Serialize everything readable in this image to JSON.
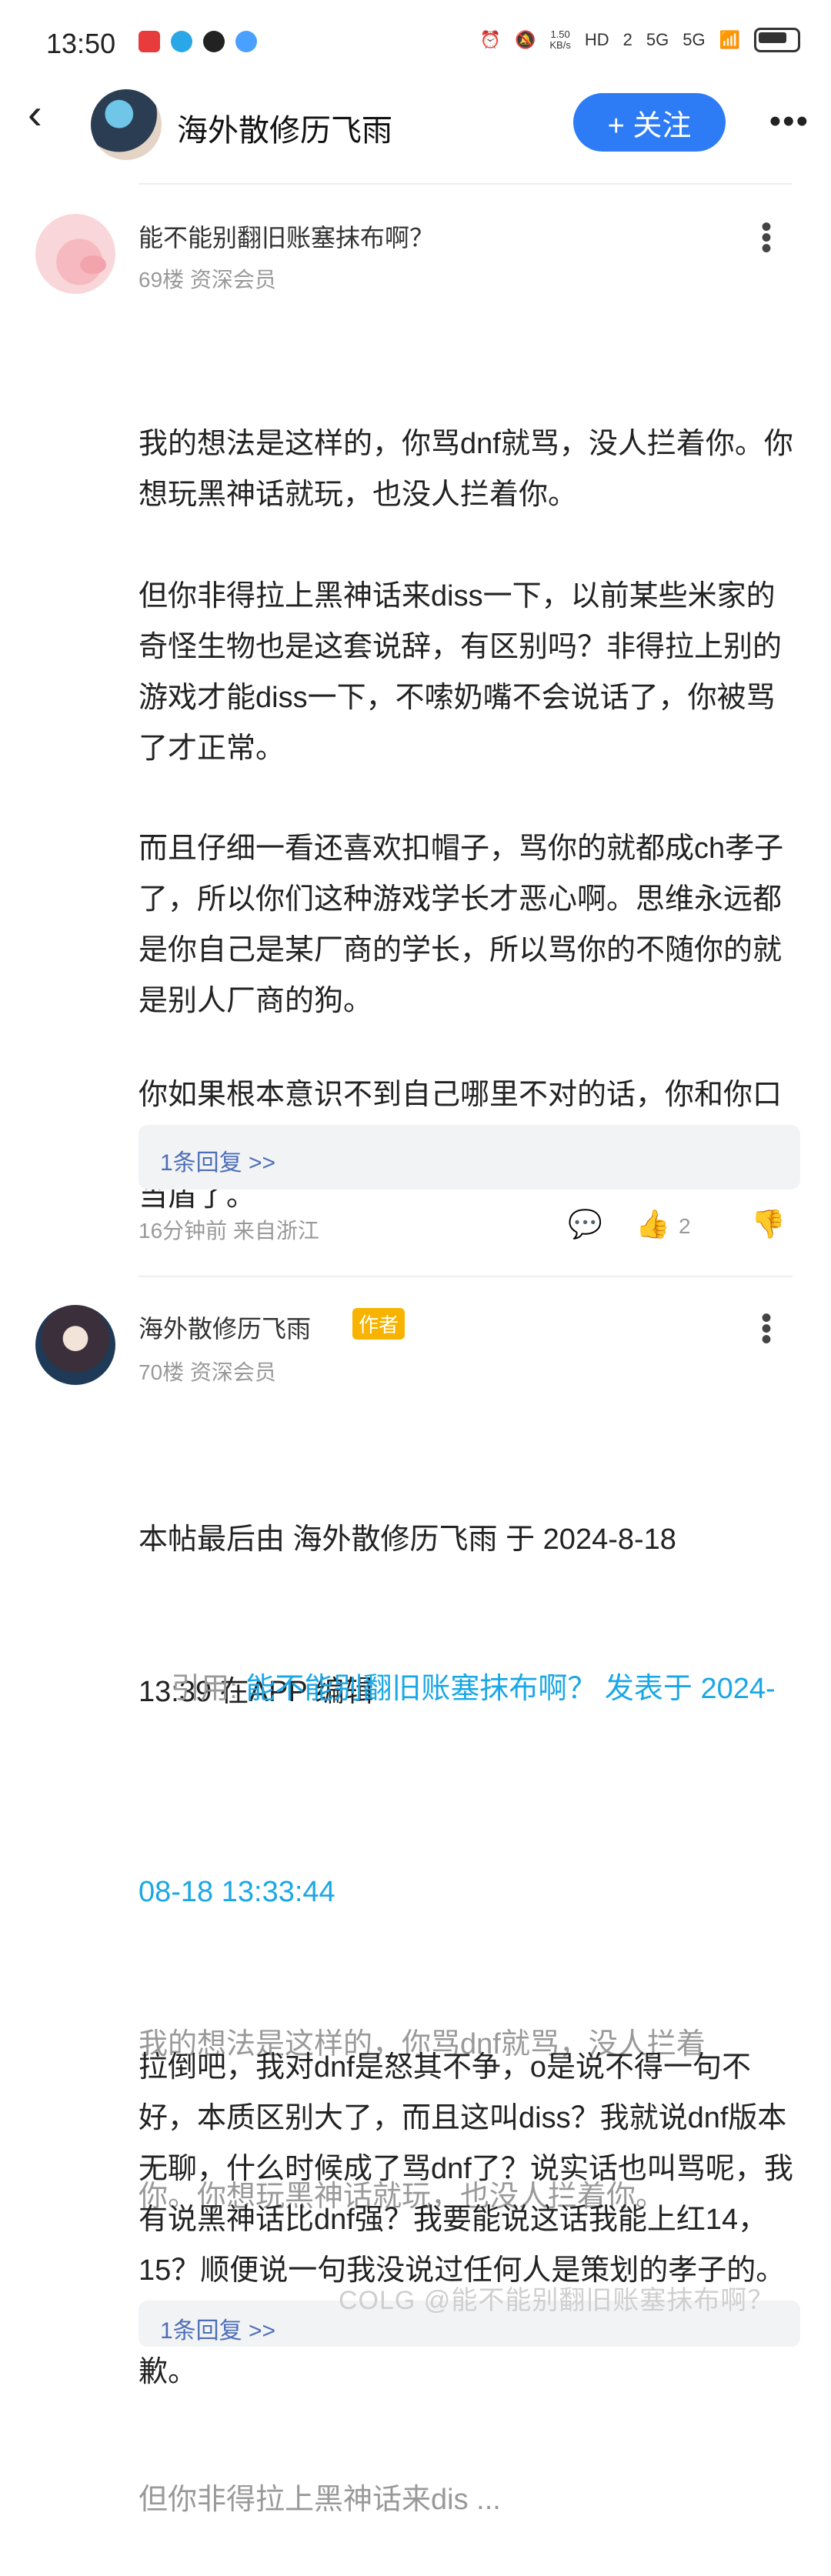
{
  "status_bar": {
    "time": "13:50",
    "net_speed_value": "1.50",
    "net_speed_unit": "KB/s",
    "network_labels": [
      "HD",
      "2",
      "5G",
      "5G"
    ],
    "battery": "battery-icon"
  },
  "nav": {
    "back_icon": "‹",
    "title": "海外散修历飞雨",
    "follow_label": "+ 关注",
    "more_icon": "•••"
  },
  "posts": [
    {
      "username": "能不能别翻旧账塞抹布啊？",
      "floor_rank": "69楼 资深会员",
      "paragraphs": [
        "我的想法是这样的，你骂dnf就骂，没人拦着你。你想玩黑神话就玩，也没人拦着你。",
        "但你非得拉上黑神话来diss一下，以前某些米家的奇怪生物也是这套说辞，有区别吗？非得拉上别的游戏才能diss一下，不嗦奶嘴不会说话了，你被骂了才正常。",
        "而且仔细一看还喜欢扣帽子，骂你的就都成ch孝子了，所以你们这种游戏学长才恶心啊。思维永远都是你自己是某厂商的学长，所以骂你的不随你的就是别人厂商的狗。",
        "你如果根本意识不到自己哪里不对的话，你和你口中的恶臭群体无非就是你那天黑神话当盾，人家拿o当盾了。"
      ],
      "reply_link": "1条回复 >>",
      "time_location": "16分钟前 来自浙江",
      "like_count": "2"
    },
    {
      "username": "海外散修历飞雨",
      "author_tag": "作者",
      "floor_rank": "70楼 资深会员",
      "edit_note_line1": "本帖最后由 海外散修历飞雨 于 2024-8-18",
      "edit_note_line2": "13:39 在APP 编辑",
      "quote_prefix": "引用: ",
      "quote_link_line1": "能不能别翻旧账塞抹布啊？ 发表于 2024-",
      "quote_link_line2": "08-18 13:33:44",
      "quote_text_line1": "我的想法是这样的，你骂dnf就骂，没人拦着",
      "quote_text_line2": "你。你想玩黑神话就玩，也没人拦着你。",
      "quote_text_line3": "但你非得拉上黑神话来dis ...",
      "reply_paragraph": "拉倒吧，我对dnf是怒其不争，o是说不得一句不好，本质区别大了，而且这叫diss？我就说dnf版本无聊，什么时候成了骂dnf了？说实话也叫骂呢，我有说黑神话比dnf强？我要能说这话我能上红14，15？顺便说一句我没说过任何人是策划的孝子的。你找出来我我任何一句我扣别人帽子的话我给你道歉。",
      "reply_link_partial": "1条回复 >>"
    }
  ],
  "watermark": "COLG @能不能别翻旧账塞抹布啊？"
}
